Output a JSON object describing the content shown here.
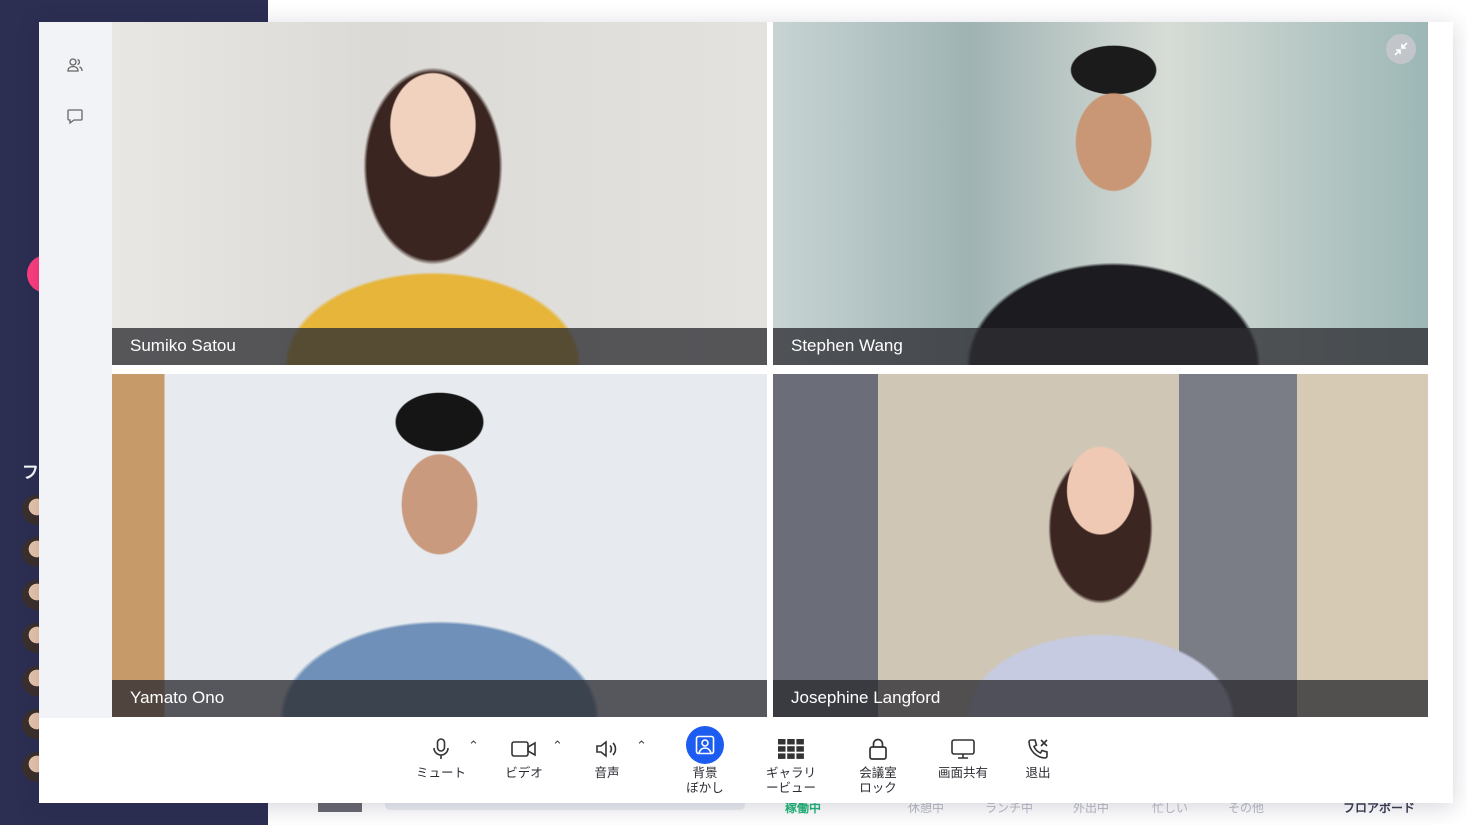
{
  "background_app": {
    "sidebar_heading": "フ",
    "status_tabs": [
      "稼働中",
      "休憩中",
      "ランチ中",
      "外出中",
      "忙しい",
      "その他"
    ],
    "floor_board_label": "フロアボード",
    "colors": {
      "sidebar": "#2c2f52",
      "accent_pink": "#ff3f7f",
      "active_status": "#25b87a"
    }
  },
  "meeting": {
    "rail": {
      "participants_icon": "participants-icon",
      "chat_icon": "chat-icon"
    },
    "collapse_icon": "minimize-arrows-icon",
    "participants": [
      {
        "name": "Sumiko Satou"
      },
      {
        "name": "Stephen Wang"
      },
      {
        "name": "Yamato Ono"
      },
      {
        "name": "Josephine Langford"
      }
    ],
    "toolbar": {
      "mute": {
        "label": "ミュート",
        "icon": "microphone-icon"
      },
      "video": {
        "label": "ビデオ",
        "icon": "camera-icon"
      },
      "audio": {
        "label": "音声",
        "icon": "speaker-icon"
      },
      "blur": {
        "label": "背景\nぼかし",
        "icon": "background-blur-icon",
        "active": true,
        "color": "#1d5cf0"
      },
      "gallery": {
        "label": "ギャラリ\nービュー",
        "icon": "grid-icon"
      },
      "lock": {
        "label": "会議室\nロック",
        "icon": "lock-icon"
      },
      "share": {
        "label": "画面共有",
        "icon": "monitor-icon"
      },
      "leave": {
        "label": "退出",
        "icon": "phone-hangup-icon"
      }
    }
  }
}
